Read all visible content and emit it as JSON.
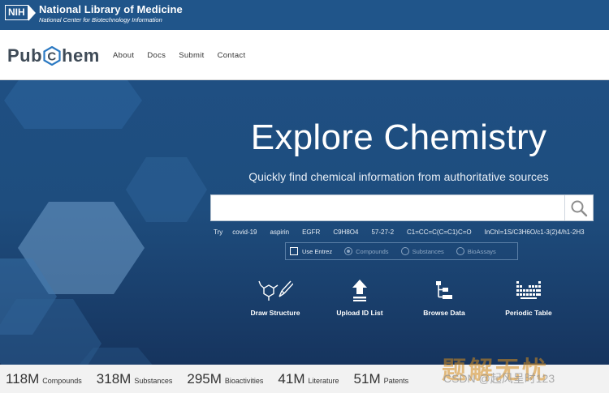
{
  "nih": {
    "logo_text": "NIH",
    "title": "National Library of Medicine",
    "subtitle": "National Center for Biotechnology Information"
  },
  "header": {
    "logo_left": "Pub",
    "logo_right": "hem",
    "nav": [
      "About",
      "Docs",
      "Submit",
      "Contact"
    ]
  },
  "hero": {
    "title": "Explore Chemistry",
    "subtitle": "Quickly find chemical information from authoritative sources",
    "search": {
      "value": "",
      "placeholder": ""
    },
    "try_label": "Try",
    "try_examples": [
      "covid-19",
      "aspirin",
      "EGFR",
      "C9H8O4",
      "57-27-2",
      "C1=CC=C(C=C1)C=O",
      "InChI=1S/C3H6O/c1-3(2)4/h1-2H3"
    ],
    "options": {
      "use_entrez": "Use Entrez",
      "radio": [
        "Compounds",
        "Substances",
        "BioAssays"
      ]
    },
    "actions": [
      "Draw Structure",
      "Upload ID List",
      "Browse Data",
      "Periodic Table"
    ]
  },
  "stats": [
    {
      "num": "118M",
      "label": "Compounds"
    },
    {
      "num": "318M",
      "label": "Substances"
    },
    {
      "num": "295M",
      "label": "Bioactivities"
    },
    {
      "num": "41M",
      "label": "Literature"
    },
    {
      "num": "51M",
      "label": "Patents"
    }
  ],
  "watermark": {
    "line1": "题解无忧",
    "line2": "CSDN @起风呈时123"
  },
  "colors": {
    "nih_bar": "#20558a",
    "hero_top": "#1f4f82",
    "hero_bottom": "#16345e",
    "logo_text": "#3f4b57",
    "logo_hex": "#2b79c2"
  },
  "icons": [
    "search-icon",
    "draw-structure-icon",
    "upload-icon",
    "browse-data-icon",
    "periodic-table-icon"
  ]
}
